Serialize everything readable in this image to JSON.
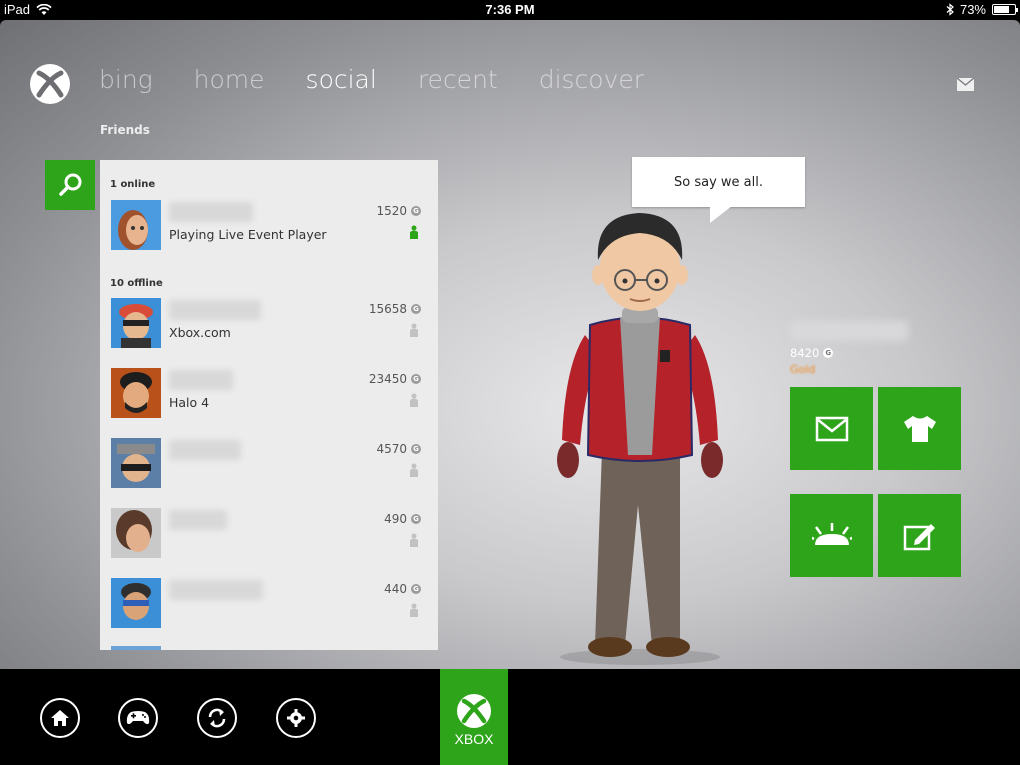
{
  "status_bar": {
    "device": "iPad",
    "time": "7:36 PM",
    "battery": "73%",
    "battery_level": 0.73
  },
  "nav": {
    "items": [
      "bing",
      "home",
      "social",
      "recent",
      "discover"
    ],
    "active": "social"
  },
  "section_label": "Friends",
  "friends": {
    "online_header": "1 online",
    "offline_header": "10 offline",
    "online": [
      {
        "status": "Playing Live Event Player",
        "score": "1520",
        "presence": "online"
      }
    ],
    "offline": [
      {
        "status": "Xbox.com",
        "score": "15658"
      },
      {
        "status": "Halo 4",
        "score": "23450"
      },
      {
        "status": "",
        "score": "4570"
      },
      {
        "status": "",
        "score": "490"
      },
      {
        "status": "",
        "score": "440"
      }
    ]
  },
  "profile": {
    "motto": "So say we all.",
    "gamerscore": "8420",
    "tier": "Gold"
  },
  "tiles": [
    {
      "icon": "mail-icon"
    },
    {
      "icon": "tshirt-icon"
    },
    {
      "icon": "beacon-icon"
    },
    {
      "icon": "edit-icon"
    }
  ],
  "bottom_bar": {
    "buttons": [
      "home-icon",
      "controller-icon",
      "refresh-icon",
      "settings-icon"
    ],
    "xbox_label": "XBOX"
  },
  "colors": {
    "accent": "#2ea41a",
    "tier_gold": "#f18a1b",
    "panel": "#ececec"
  }
}
